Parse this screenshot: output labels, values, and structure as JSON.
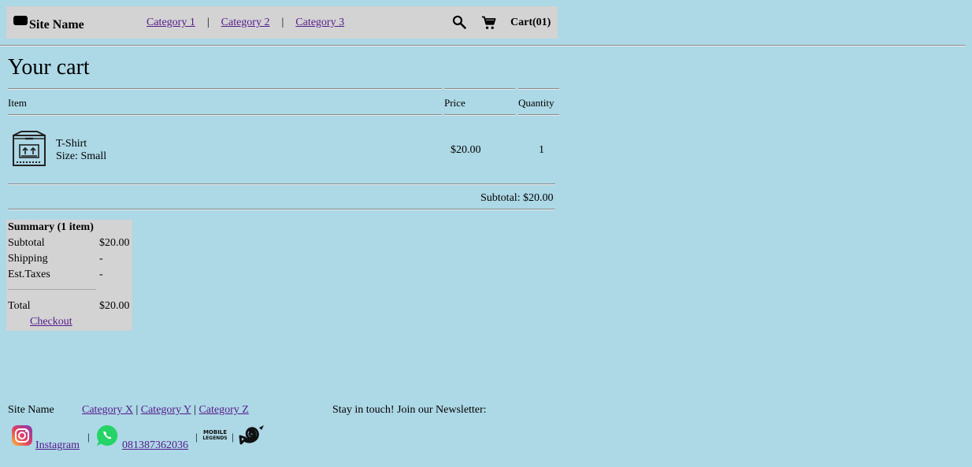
{
  "header": {
    "site_name": "Site Name",
    "categories": [
      "Category 1",
      "Category 2",
      "Category 3"
    ],
    "separator": "|",
    "search_icon": "search-icon",
    "cart_icon": "cart-icon",
    "cart_label": "Cart(01)"
  },
  "page_title": "Your cart",
  "cart": {
    "columns": {
      "item": "Item",
      "price": "Price",
      "quantity": "Quantity"
    },
    "items": [
      {
        "name": "T-Shirt",
        "size": "Size: Small",
        "price": "$20.00",
        "quantity": "1",
        "icon": "box-icon"
      }
    ],
    "subtotal": "Subtotal: $20.00"
  },
  "summary": {
    "title": "Summary (1 item)",
    "rows": [
      {
        "label": "Subtotal",
        "value": "$20.00"
      },
      {
        "label": "Shipping",
        "value": "-"
      },
      {
        "label": "Est.Taxes",
        "value": "-"
      }
    ],
    "total_label": "Total",
    "total_value": "$20.00",
    "checkout": "Checkout"
  },
  "footer": {
    "site_name": "Site Name",
    "categories": [
      "Category X",
      "Category Y",
      "Category Z"
    ],
    "separator": "|",
    "newsletter": "Stay in touch! Join our Newsletter:",
    "instagram": "Instagram",
    "whatsapp": "081387362036",
    "mobile_legends_text": "MOBILE LEGENDS",
    "icons": [
      "instagram-icon",
      "whatsapp-icon",
      "mobile-legends-icon",
      "swirl-icon"
    ]
  },
  "colors": {
    "background": "#add8e6",
    "panel": "#d3d3d3",
    "link": "#551a8b"
  }
}
